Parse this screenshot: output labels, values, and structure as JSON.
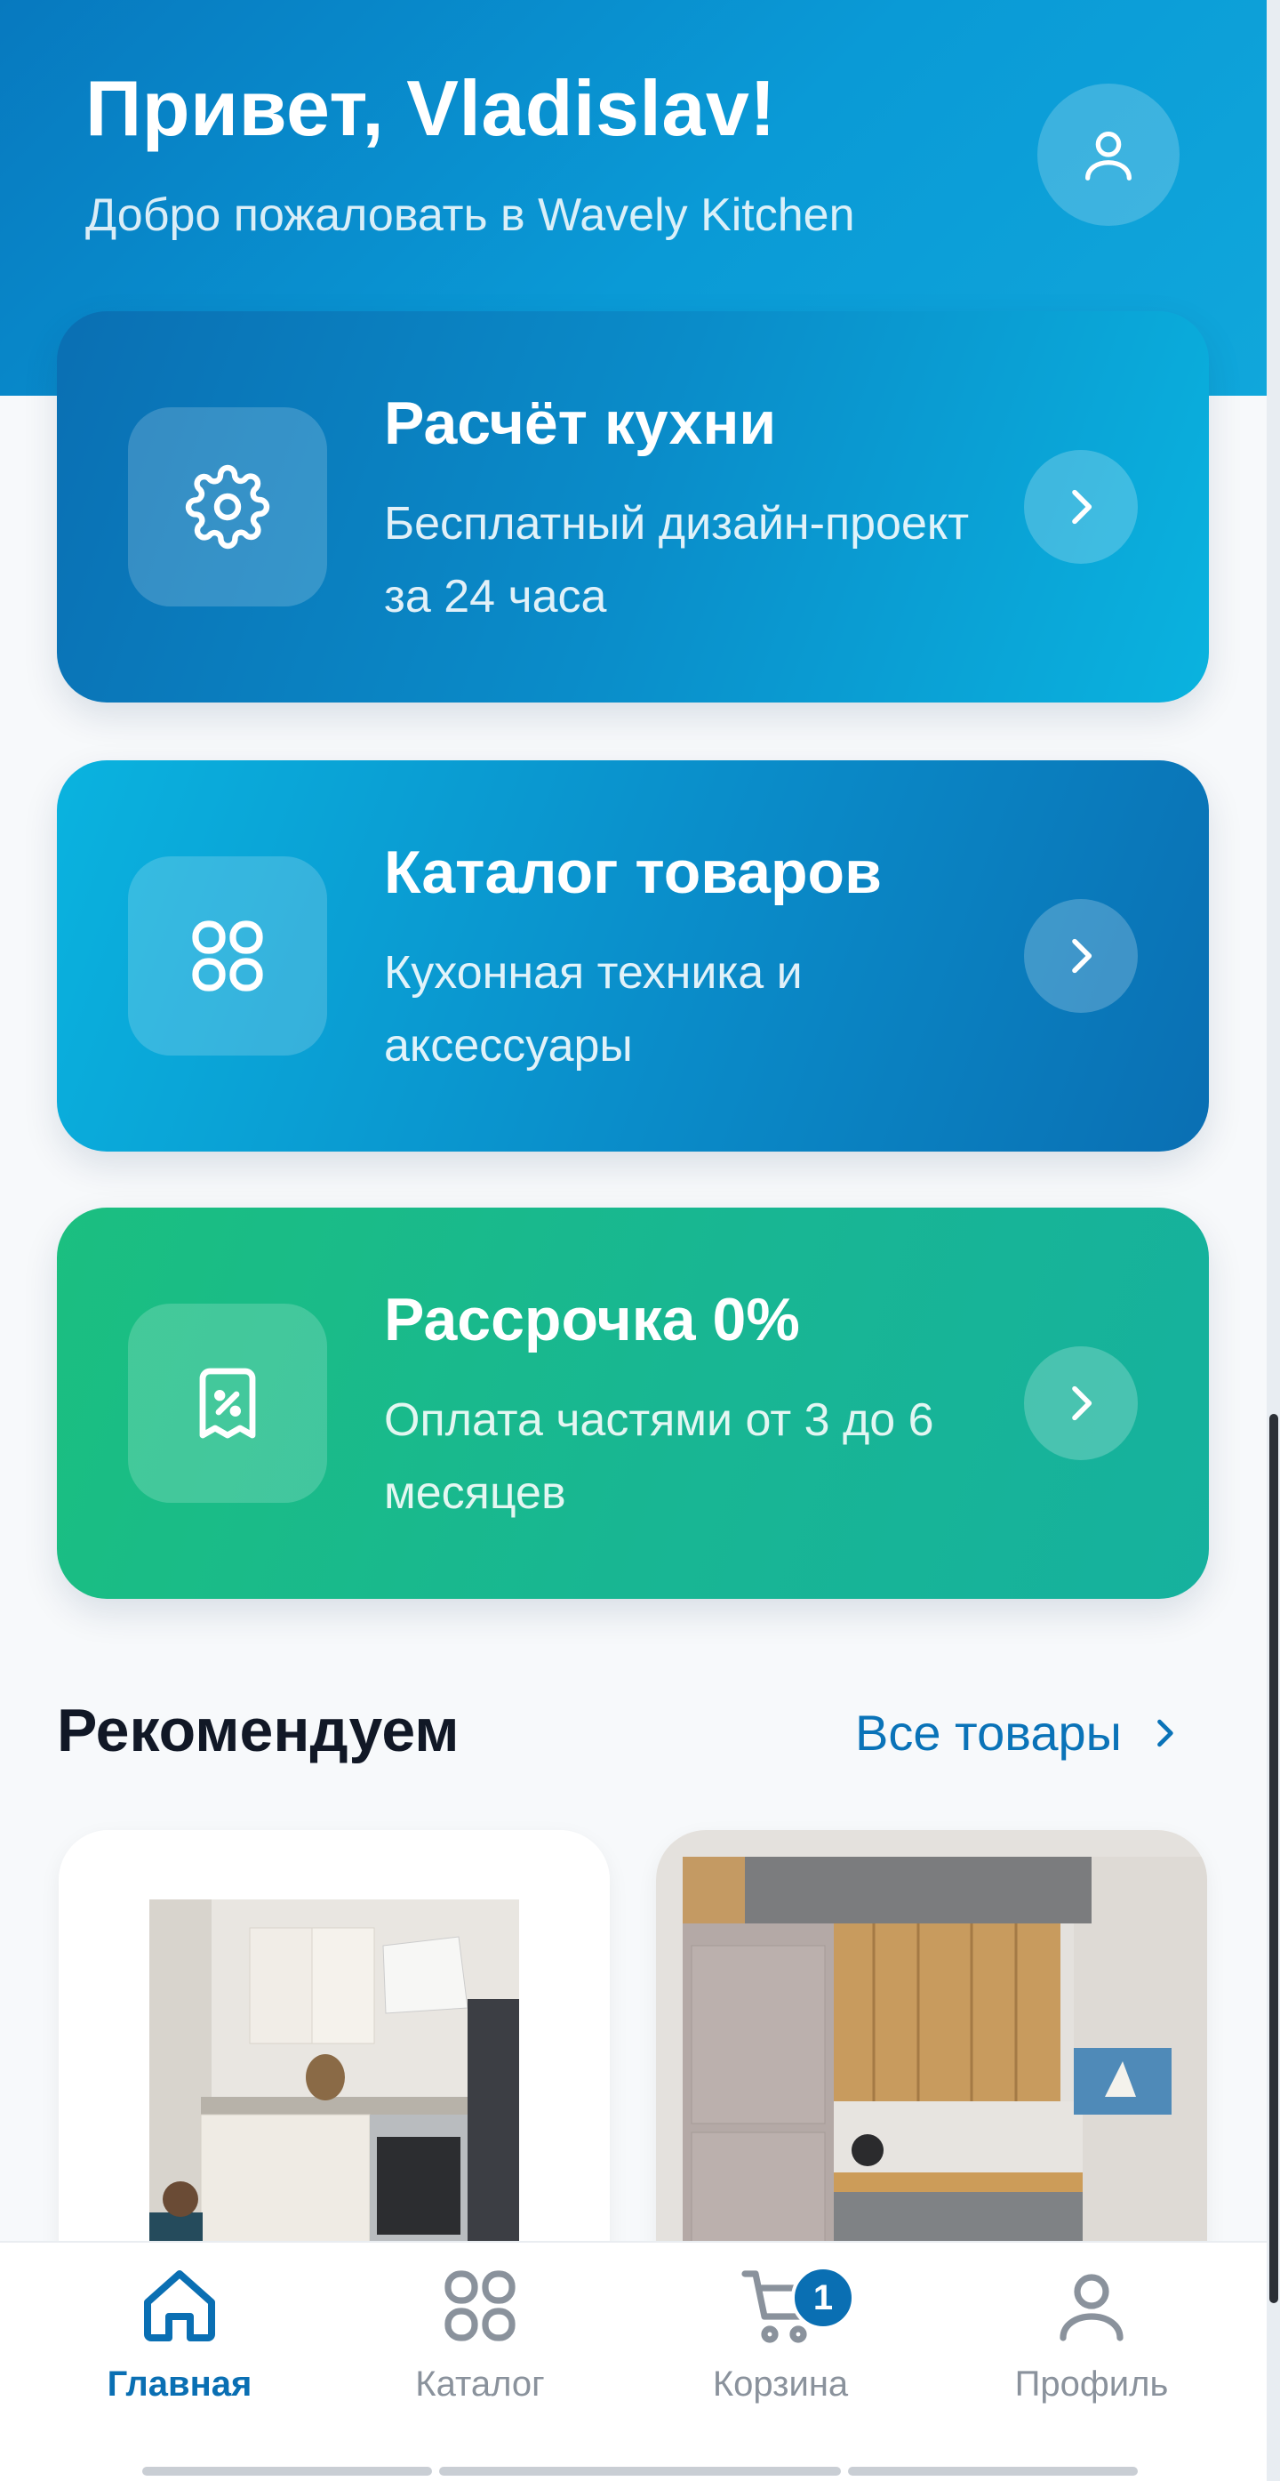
{
  "header": {
    "greeting": "Привет, Vladislav!",
    "subtitle": "Добро пожаловать в Wavely Kitchen",
    "profile_icon": "user-icon"
  },
  "cards": [
    {
      "title": "Расчёт кухни",
      "description": "Бесплатный дизайн-проект за 24 часа",
      "icon": "gear-icon"
    },
    {
      "title": "Каталог товаров",
      "description": "Кухонная техника и аксессуары",
      "icon": "grid-icon"
    },
    {
      "title": "Рассрочка 0%",
      "description": "Оплата частями от 3 до 6 месяцев",
      "icon": "receipt-percent-icon"
    }
  ],
  "recommend": {
    "title": "Рекомендуем",
    "all_link": "Все товары"
  },
  "nav": {
    "items": [
      {
        "label": "Главная",
        "icon": "home-icon",
        "active": true
      },
      {
        "label": "Каталог",
        "icon": "grid-icon"
      },
      {
        "label": "Корзина",
        "icon": "cart-icon",
        "badge": "1"
      },
      {
        "label": "Профиль",
        "icon": "user-icon"
      }
    ]
  },
  "colors": {
    "primary": "#0a6fb3",
    "accent_green": "#18b693",
    "text_dark": "#111826",
    "muted": "#8a929c"
  }
}
